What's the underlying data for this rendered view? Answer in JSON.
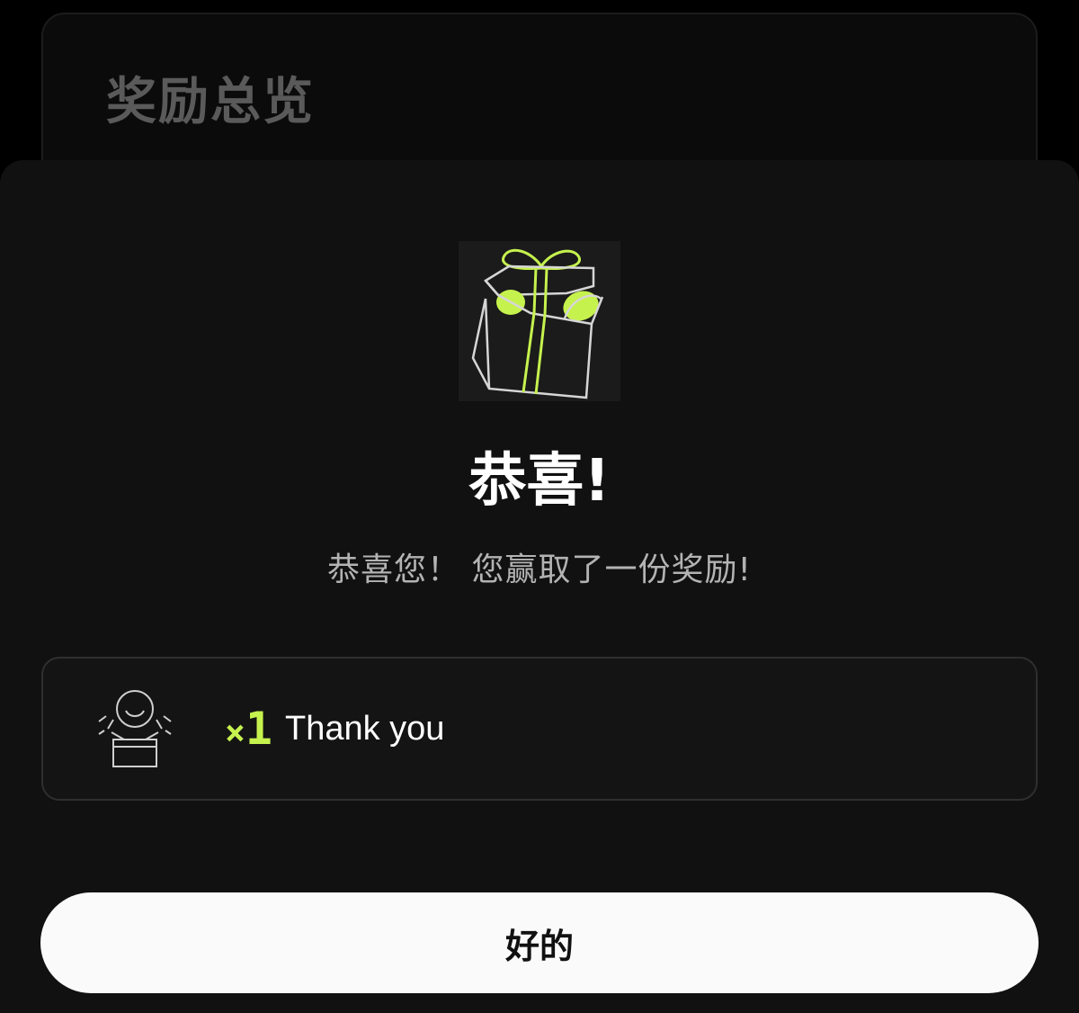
{
  "background_card": {
    "title": "奖励总览"
  },
  "modal": {
    "icon": "gift-box-icon",
    "title": "恭喜!",
    "subtitle": "恭喜您！ 您赢取了一份奖励!",
    "reward": {
      "icon": "thank-you-person-icon",
      "multiplier_prefix": "×",
      "multiplier_value": "1",
      "name": "Thank you"
    },
    "confirm_label": "好的"
  },
  "colors": {
    "accent": "#c6f24e",
    "background": "#000000",
    "sheet": "#111111",
    "button": "#fafafa"
  }
}
